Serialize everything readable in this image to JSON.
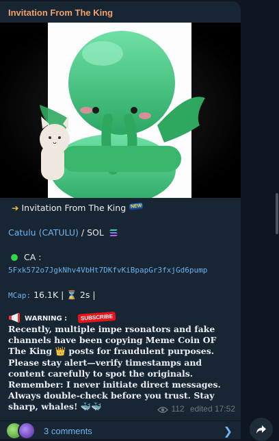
{
  "post": {
    "channel_name": "Invitation From The King",
    "invite_text": "Invitation From The King",
    "new_badge": "NEW",
    "token_name": "Catulu (CATULU)",
    "token_separator": " / SOL",
    "ca_label": "CA :",
    "ca_value": "5Fxk572o7JgkNhv4VbHt7DKfvKiBpapGr3fxjGd6pump",
    "mcap_label": "MCap:",
    "mcap_value": "16.1K",
    "mcap_sep": "|",
    "age_value": "2s",
    "age_sep": "|",
    "warning_label": "WARNING :",
    "subscribe_label": "SUBSCRIBE",
    "warning_body": "Recently, multiple impe rsonators and fake channels have been copying Meme Coin OF The King 👑 posts for fraudulent purposes. Please stay alert—verify timestamps and content carefully to spot the originals. Remember: I never initiate direct messages. Always double-check before you trust. Stay sharp, whales! 🐳🐳",
    "views": "112",
    "edited": "edited 17:52"
  },
  "comments": {
    "label": "3 comments"
  },
  "icons": {
    "arrow": "right-arrow-icon",
    "sol": "solana-icon",
    "dot": "green-circle-icon",
    "hourglass": "hourglass-icon",
    "megaphone": "megaphone-icon",
    "eye": "eye-icon",
    "chevron": "chevron-right-icon",
    "share": "share-icon"
  },
  "colors": {
    "background": "#0e1621",
    "bubble": "#182533",
    "channel_name": "#f0a36b",
    "link": "#71b7f5",
    "text": "#e9eef3",
    "muted": "#6c7883"
  }
}
